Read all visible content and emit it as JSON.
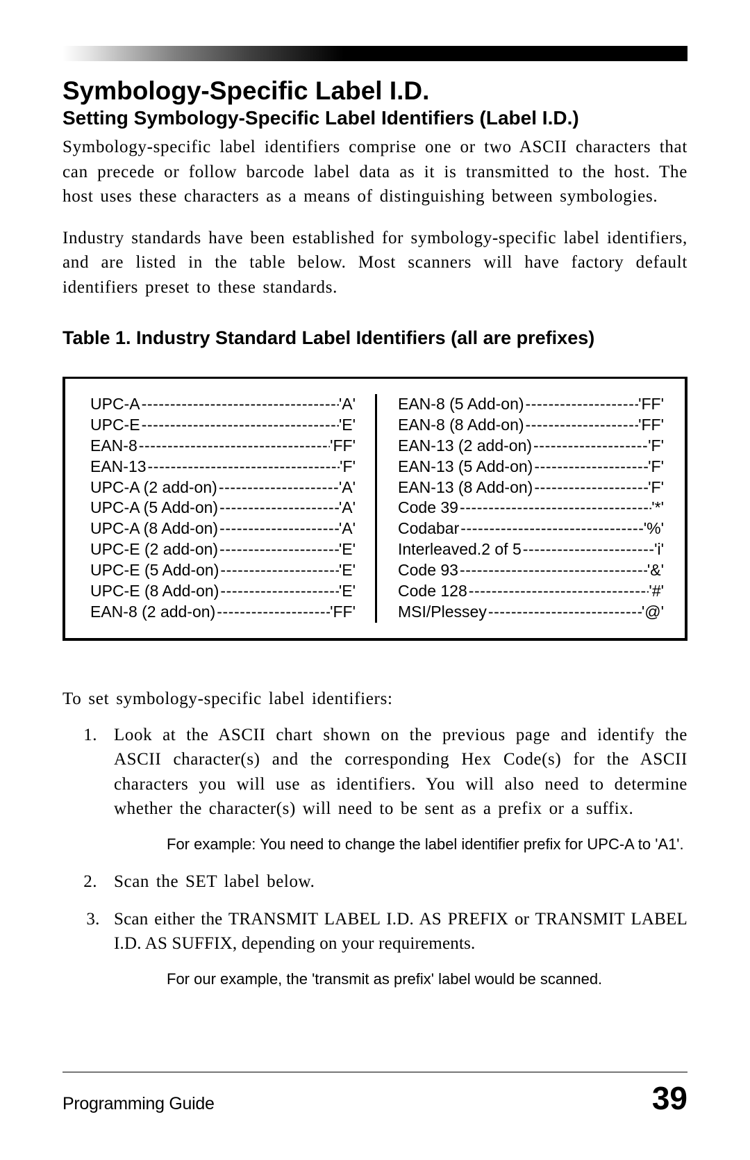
{
  "header": {
    "title": "Symbology-Specific Label I.D.",
    "subtitle": "Setting Symbology-Specific Label Identifiers (Label I.D.)"
  },
  "paragraphs": {
    "p1": "Symbology-specific label identifiers comprise one or two ASCII characters that can precede or follow barcode label data as it is transmitted to the host.  The host uses these characters as a means of distinguishing between symbologies.",
    "p2": "Industry standards have been established for symbology-specific label identifiers, and are listed in the table below.  Most scanners will have factory default identifiers preset to these standards."
  },
  "table": {
    "title": "Table 1.  Industry Standard Label Identifiers (all are prefixes)",
    "left": [
      {
        "label": "UPC-A",
        "code": "'A'"
      },
      {
        "label": "UPC-E",
        "code": "'E'"
      },
      {
        "label": "EAN-8",
        "code": "'FF'"
      },
      {
        "label": "EAN-13",
        "code": "'F'"
      },
      {
        "label": "UPC-A (2 add-on)",
        "code": "'A'"
      },
      {
        "label": "UPC-A (5 Add-on)",
        "code": "'A'"
      },
      {
        "label": "UPC-A (8 Add-on)",
        "code": "'A'"
      },
      {
        "label": "UPC-E (2 add-on)",
        "code": "'E'"
      },
      {
        "label": "UPC-E (5 Add-on)",
        "code": "'E'"
      },
      {
        "label": "UPC-E (8 Add-on)",
        "code": "'E'"
      },
      {
        "label": "EAN-8 (2 add-on)",
        "code": "'FF'"
      }
    ],
    "right": [
      {
        "label": "EAN-8 (5 Add-on)",
        "code": "'FF'"
      },
      {
        "label": "EAN-8 (8 Add-on)",
        "code": "'FF'"
      },
      {
        "label": "EAN-13 (2 add-on)",
        "code": "'F'"
      },
      {
        "label": "EAN-13 (5 Add-on)",
        "code": "'F'"
      },
      {
        "label": "EAN-13 (8 Add-on)",
        "code": "'F'"
      },
      {
        "label": "Code 39",
        "code": "'*'"
      },
      {
        "label": "Codabar",
        "code": "'%'"
      },
      {
        "label": "Interleaved.2 of 5",
        "code": "'i'"
      },
      {
        "label": "Code 93",
        "code": "'&'"
      },
      {
        "label": "Code 128",
        "code": "'#'"
      },
      {
        "label": "MSI/Plessey",
        "code": "'@'"
      }
    ]
  },
  "instructions": {
    "lead": "To set symbology-specific label identifiers:",
    "steps": [
      "Look at the ASCII chart shown on the previous page and identify the ASCII character(s) and the corresponding Hex Code(s) for the ASCII characters you will use as identifiers.  You will also need to determine whether the character(s) will need to be sent as a prefix or a suffix.",
      "Scan the SET label below.",
      "Scan either the TRANSMIT LABEL I.D. AS PREFIX or TRANSMIT LABEL I.D. AS SUFFIX, depending on your requirements."
    ],
    "example1": "For example:  You need to change the label identifier prefix for UPC-A to 'A1'.",
    "example2": "For our example, the 'transmit as prefix' label would be scanned."
  },
  "footer": {
    "left": "Programming Guide",
    "page": "39"
  },
  "dash_fill": "------------------------------------------------------------"
}
